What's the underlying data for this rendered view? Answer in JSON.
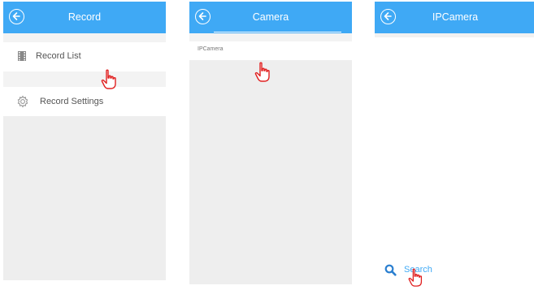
{
  "screens": [
    {
      "title": "Record",
      "items": [
        {
          "label": "Record List",
          "icon": "film-icon"
        },
        {
          "label": "Record Settings",
          "icon": "gear-icon"
        }
      ]
    },
    {
      "title": "Camera",
      "items": [
        {
          "label": "IPCamera"
        }
      ]
    },
    {
      "title": "IPCamera",
      "search_label": "Search"
    }
  ],
  "colors": {
    "header": "#3fa9f5",
    "panel_bg": "#eeeeee",
    "pointer": "#e02020",
    "accent": "#3fa9f5"
  },
  "icons": {
    "back": "back-arrow-circle-icon",
    "pointer": "pointing-hand-icon",
    "search": "search-icon"
  }
}
